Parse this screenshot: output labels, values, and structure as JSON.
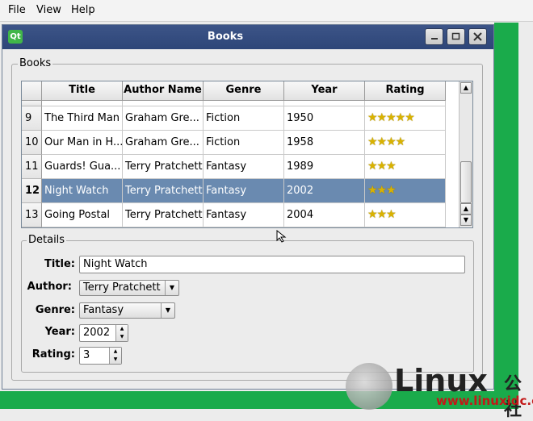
{
  "menubar": {
    "items": [
      "File",
      "View",
      "Help"
    ]
  },
  "window": {
    "title": "Books",
    "logo": "Qt"
  },
  "books_group": {
    "label": "Books"
  },
  "table": {
    "columns": [
      "Title",
      "Author Name",
      "Genre",
      "Year",
      "Rating"
    ],
    "rows": [
      {
        "num": "9",
        "title": "The Third Man",
        "author": "Graham Gre...",
        "genre": "Fiction",
        "year": "1950",
        "stars": "★★★★★",
        "rating": 5
      },
      {
        "num": "10",
        "title": "Our Man in H...",
        "author": "Graham Gre...",
        "genre": "Fiction",
        "year": "1958",
        "stars": "★★★★",
        "rating": 4
      },
      {
        "num": "11",
        "title": "Guards! Gua...",
        "author": "Terry Pratchett",
        "genre": "Fantasy",
        "year": "1989",
        "stars": "★★★",
        "rating": 3
      },
      {
        "num": "12",
        "title": "Night Watch",
        "author": "Terry Pratchett",
        "genre": "Fantasy",
        "year": "2002",
        "stars": "★★★",
        "rating": 3,
        "selected": true
      },
      {
        "num": "13",
        "title": "Going Postal",
        "author": "Terry Pratchett",
        "genre": "Fantasy",
        "year": "2004",
        "stars": "★★★",
        "rating": 3
      }
    ],
    "selection_color": "#6a8ab0"
  },
  "details": {
    "label": "Details",
    "title_label": "Title:",
    "title_value": "Night Watch",
    "author_label": "Author:",
    "author_value": "Terry Pratchett",
    "genre_label": "Genre:",
    "genre_value": "Fantasy",
    "year_label": "Year:",
    "year_value": "2002",
    "rating_label": "Rating:",
    "rating_value": "3"
  },
  "watermark": {
    "brand": "Linux",
    "cn": "公社",
    "url": "www.linuxidc.com"
  },
  "colors": {
    "titlebar": "#3d5588",
    "desktop": "#1aab4b"
  }
}
